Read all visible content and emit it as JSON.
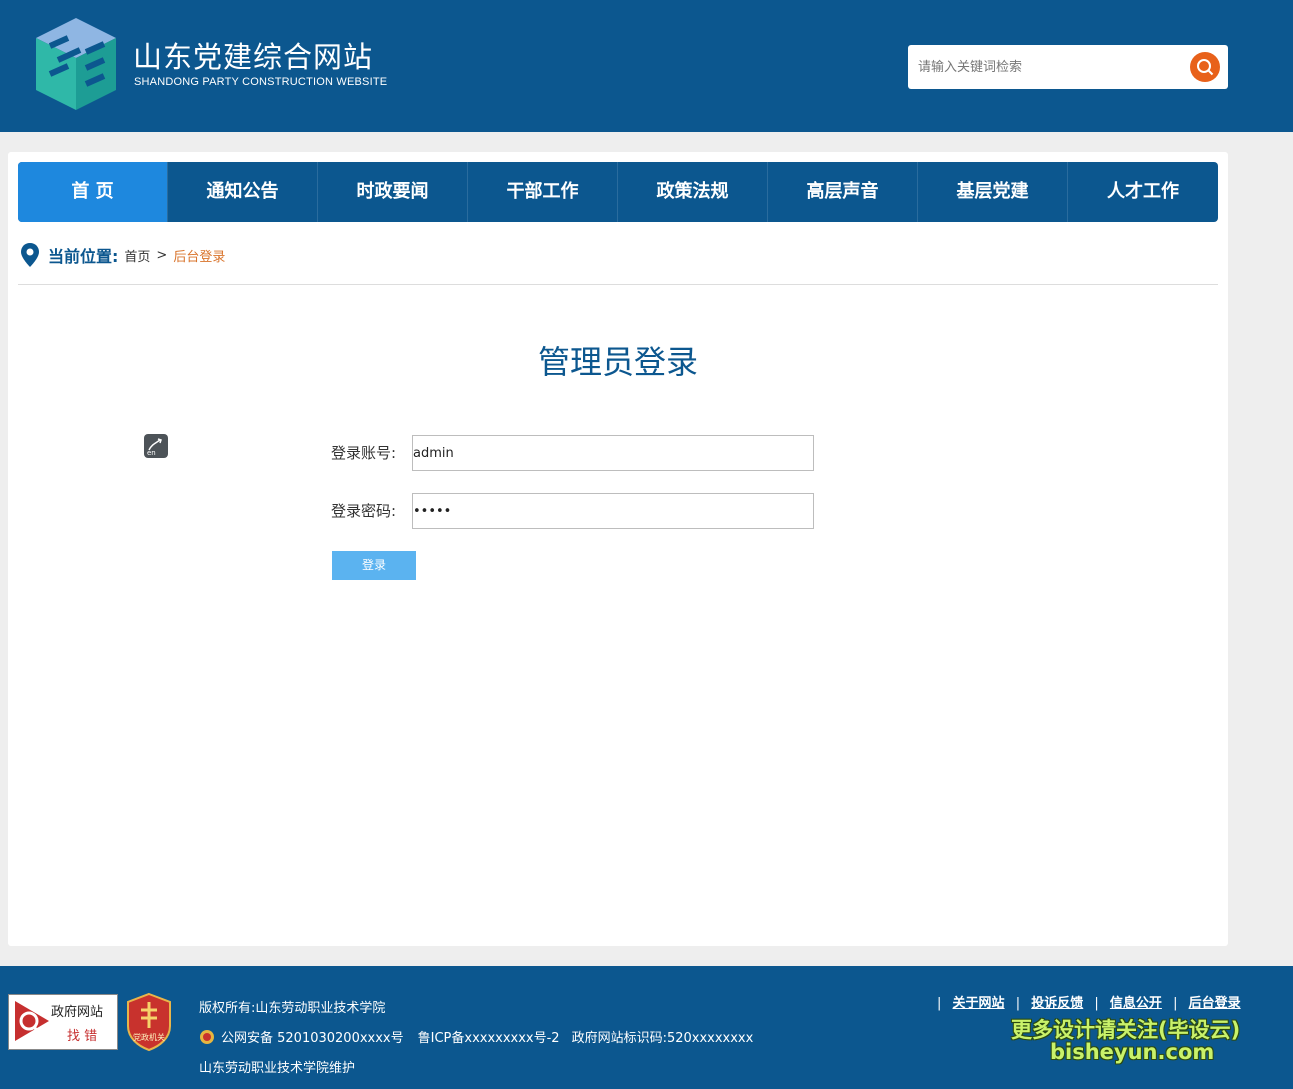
{
  "header": {
    "site_name": "山东党建综合网站",
    "site_name_en": "SHANDONG PARTY CONSTRUCTION WEBSITE",
    "search_placeholder": "请输入关键词检索",
    "search_icon": "search-icon"
  },
  "nav": {
    "items": [
      {
        "label": "首 页",
        "active": true
      },
      {
        "label": "通知公告"
      },
      {
        "label": "时政要闻"
      },
      {
        "label": "干部工作"
      },
      {
        "label": "政策法规"
      },
      {
        "label": "高层声音"
      },
      {
        "label": "基层党建"
      },
      {
        "label": "人才工作"
      }
    ]
  },
  "breadcrumb": {
    "label": "当前位置:",
    "home": "首页",
    "separator": ">",
    "current": "后台登录"
  },
  "login": {
    "title": "管理员登录",
    "account_label": "登录账号:",
    "account_value": "admin",
    "password_label": "登录密码:",
    "password_value": "•••••",
    "submit_label": "登录"
  },
  "footer": {
    "badge_gov_top": "政府网站",
    "badge_gov_bottom": "找 错",
    "badge_party": "党政机关",
    "copyright": "版权所有:山东劳动职业技术学院",
    "police_record": "公网安备 5201030200xxxx号",
    "icp": "鲁ICP备xxxxxxxxx号-2",
    "gov_id": "政府网站标识码:520xxxxxxxx",
    "maintainer": "山东劳动职业技术学院维护",
    "links": [
      "关于网站",
      "投诉反馈",
      "信息公开",
      "后台登录"
    ],
    "link_sep": "|"
  },
  "watermark": {
    "line1": "更多设计请关注(毕设云)",
    "line2": "bisheyun.com"
  },
  "colors": {
    "brand_blue": "#0c578f",
    "nav_active": "#1e88de",
    "accent_orange": "#e8611a",
    "breadcrumb_current": "#d9742c",
    "button_blue": "#5bb3f0"
  }
}
